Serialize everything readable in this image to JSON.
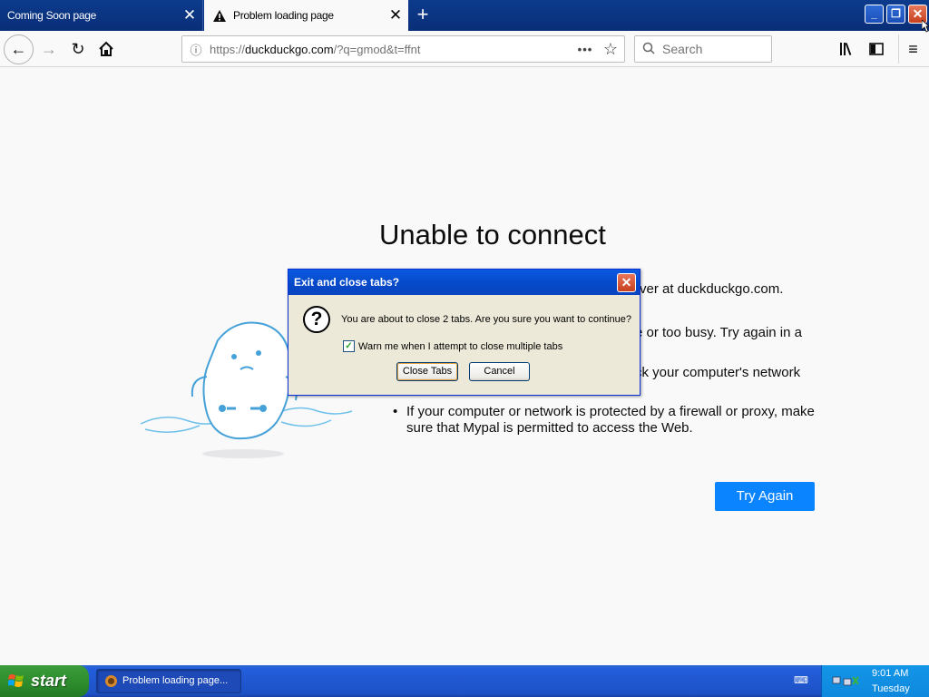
{
  "tabs": [
    {
      "label": "Coming Soon page",
      "active": false
    },
    {
      "label": "Problem loading page",
      "active": true
    }
  ],
  "navbar": {
    "url_prefix": "https://",
    "url_host": "duckduckgo.com",
    "url_rest": "/?q=gmod&t=ffnt",
    "search_placeholder": "Search",
    "more_label": "•••"
  },
  "error": {
    "title": "Unable to connect",
    "p1": "rver at duckduckgo.com.",
    "b2": "e or too busy. Try again in a",
    "b3": "ck your computer's network",
    "b4": "If your computer or network is protected by a firewall or proxy, make sure that Mypal is permitted to access the Web.",
    "try_again": "Try Again"
  },
  "dialog": {
    "title": "Exit and close tabs?",
    "message": "You are about to close 2 tabs. Are you sure you want to continue?",
    "checkbox_label": "Warn me when I attempt to close multiple tabs",
    "checkbox_checked": true,
    "ok_label": "Close Tabs",
    "cancel_label": "Cancel"
  },
  "taskbar": {
    "start_label": "start",
    "task_label": "Problem loading page...",
    "time": "9:01 AM",
    "day": "Tuesday"
  },
  "colors": {
    "accent": "#0a84ff",
    "titlebar": "#0a246a",
    "taskbar": "#245edb",
    "start": "#2e8e2e"
  }
}
